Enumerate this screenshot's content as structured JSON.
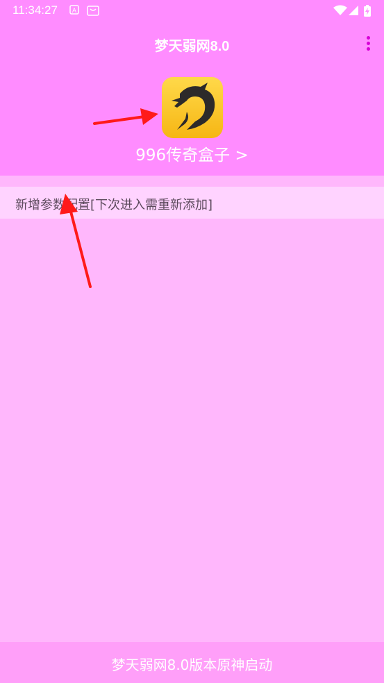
{
  "status_bar": {
    "time": "11:34:27",
    "icons": [
      "a-notification-icon",
      "store-notification-icon",
      "wifi-icon",
      "signal-icon",
      "battery-charging-icon"
    ]
  },
  "app_bar": {
    "title": "梦天弱网8.0",
    "menu_icon": "more-vert-icon"
  },
  "header": {
    "app_icon": "dragon-icon",
    "app_name": "996传奇盒子 >"
  },
  "config": {
    "label": "新增参数配置[下次进入需重新添加]"
  },
  "footer": {
    "button_label": "梦天弱网8.0版本原神启动"
  },
  "colors": {
    "app_bar": "#ff8cff",
    "background": "#ffb7fc",
    "config_row": "#ffd3ff",
    "footer": "#ff9ff9",
    "arrow": "#ff1a1a"
  }
}
